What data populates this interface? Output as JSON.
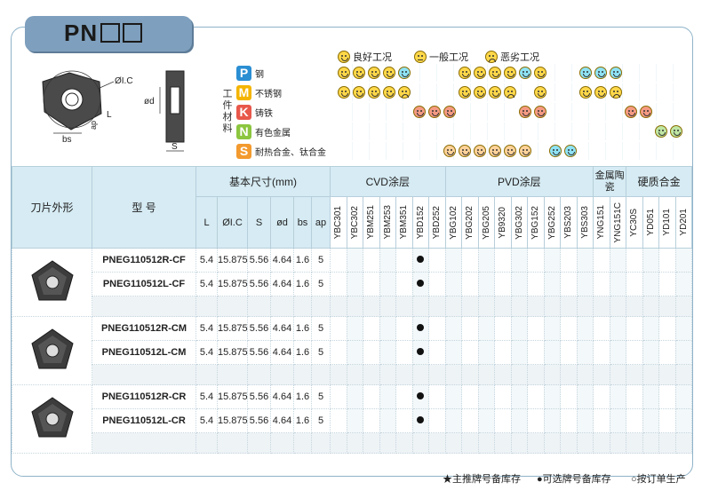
{
  "title": "PN",
  "drawing": {
    "labels": [
      "ØI.C",
      "ød",
      "L",
      "ap",
      "bs",
      "S"
    ]
  },
  "legend": [
    {
      "icon": "good-face-icon",
      "label": "良好工况"
    },
    {
      "icon": "normal-face-icon",
      "label": "一般工况"
    },
    {
      "icon": "bad-face-icon",
      "label": "恶劣工况"
    }
  ],
  "materials_label": "工件材料",
  "materials": [
    {
      "letter": "P",
      "name": "钢",
      "color": "#2a8ed3"
    },
    {
      "letter": "M",
      "name": "不锈钢",
      "color": "#f4b400"
    },
    {
      "letter": "K",
      "name": "铸铁",
      "color": "#e8584a"
    },
    {
      "letter": "N",
      "name": "有色金属",
      "color": "#8cc63f"
    },
    {
      "letter": "S",
      "name": "耐热合金、钛合金",
      "color": "#f39a2e"
    }
  ],
  "table": {
    "col_shape": "刀片外形",
    "col_model": "型 号",
    "basic_dims": "基本尺寸(mm)",
    "dim_cols": [
      "L",
      "ØI.C",
      "S",
      "ød",
      "bs",
      "ap"
    ],
    "grade_groups": [
      {
        "label": "CVD涂层",
        "grades": [
          "YBC301",
          "YBC302",
          "YBM251",
          "YBM253",
          "YBM351",
          "YBD152",
          "YBD252"
        ]
      },
      {
        "label": "PVD涂层",
        "grades": [
          "YBG102",
          "YBG202",
          "YBG205",
          "YB9320",
          "YBG302",
          "YBG152",
          "YBG252",
          "YBS203",
          "YBS303"
        ]
      },
      {
        "label": "金属陶瓷",
        "grades": [
          "YNG151",
          "YNG151C"
        ]
      },
      {
        "label": "硬质合金",
        "grades": [
          "YC30S",
          "YD051",
          "YD101",
          "YD201"
        ]
      }
    ],
    "rows": [
      {
        "model": "PNEG110512R-CF",
        "dims": [
          "5.4",
          "15.875",
          "5.56",
          "4.64",
          "1.6",
          "5"
        ],
        "mark_grade": "YBD152"
      },
      {
        "model": "PNEG110512L-CF",
        "dims": [
          "5.4",
          "15.875",
          "5.56",
          "4.64",
          "1.6",
          "5"
        ],
        "mark_grade": "YBD152"
      },
      {
        "model": "PNEG110512R-CM",
        "dims": [
          "5.4",
          "15.875",
          "5.56",
          "4.64",
          "1.6",
          "5"
        ],
        "mark_grade": "YBD152"
      },
      {
        "model": "PNEG110512L-CM",
        "dims": [
          "5.4",
          "15.875",
          "5.56",
          "4.64",
          "1.6",
          "5"
        ],
        "mark_grade": "YBD152"
      },
      {
        "model": "PNEG110512R-CR",
        "dims": [
          "5.4",
          "15.875",
          "5.56",
          "4.64",
          "1.6",
          "5"
        ],
        "mark_grade": "YBD152"
      },
      {
        "model": "PNEG110512L-CR",
        "dims": [
          "5.4",
          "15.875",
          "5.56",
          "4.64",
          "1.6",
          "5"
        ],
        "mark_grade": "YBD152"
      }
    ]
  },
  "footer": {
    "star": "★主推牌号备库存",
    "dot": "●可选牌号备库存",
    "circle": "○按订单生产"
  }
}
